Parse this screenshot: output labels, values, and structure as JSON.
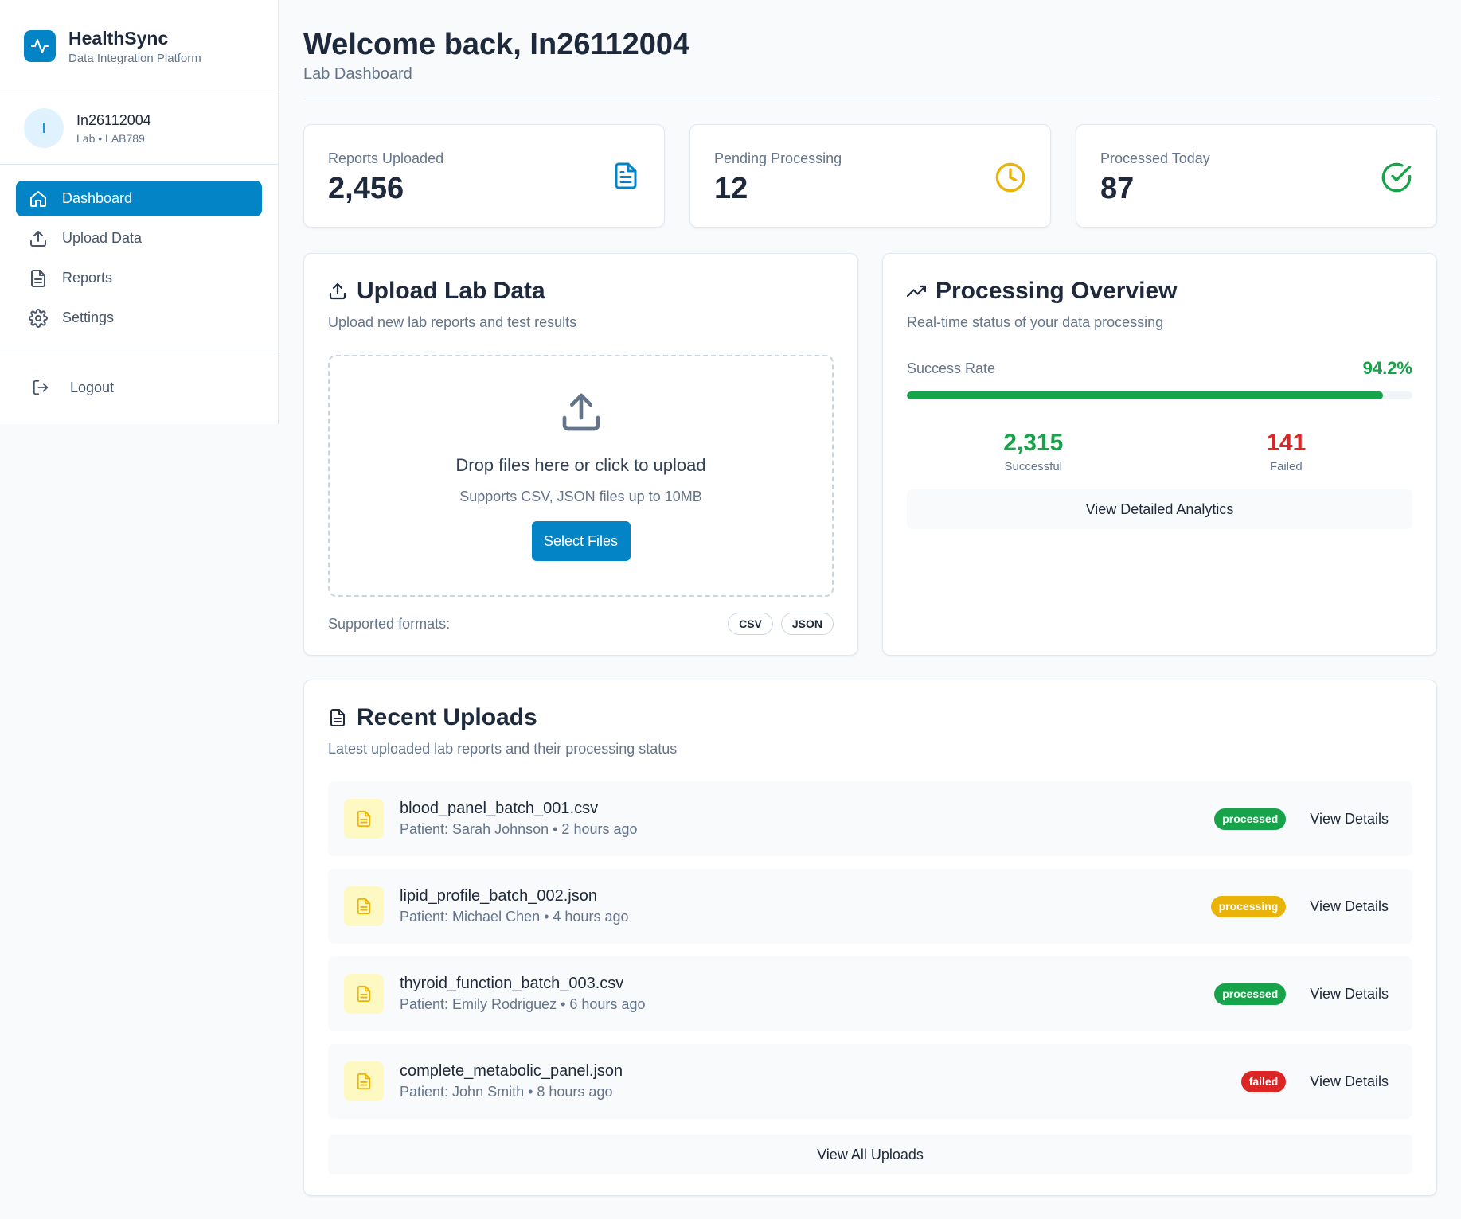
{
  "brand": {
    "name": "HealthSync",
    "subtitle": "Data Integration Platform",
    "accent": "#0284c7"
  },
  "user": {
    "initial": "I",
    "name": "In26112004",
    "meta": "Lab • LAB789"
  },
  "nav": {
    "items": [
      {
        "label": "Dashboard",
        "icon": "home-icon",
        "active": true
      },
      {
        "label": "Upload Data",
        "icon": "upload-icon",
        "active": false
      },
      {
        "label": "Reports",
        "icon": "document-icon",
        "active": false
      },
      {
        "label": "Settings",
        "icon": "gear-icon",
        "active": false
      }
    ],
    "logout": "Logout"
  },
  "header": {
    "title": "Welcome back, In26112004",
    "subtitle": "Lab Dashboard"
  },
  "stats": [
    {
      "label": "Reports Uploaded",
      "value": "2,456",
      "icon": "document-icon",
      "color": "#0284c7"
    },
    {
      "label": "Pending Processing",
      "value": "12",
      "icon": "clock-icon",
      "color": "#eab308"
    },
    {
      "label": "Processed Today",
      "value": "87",
      "icon": "check-circle-icon",
      "color": "#16a34a"
    }
  ],
  "upload": {
    "title": "Upload Lab Data",
    "subtitle": "Upload new lab reports and test results",
    "drop_title": "Drop files here or click to upload",
    "drop_sub": "Supports CSV, JSON files up to 10MB",
    "button": "Select Files",
    "formats_label": "Supported formats:",
    "formats": [
      "CSV",
      "JSON"
    ]
  },
  "processing": {
    "title": "Processing Overview",
    "subtitle": "Real-time status of your data processing",
    "rate_label": "Success Rate",
    "rate_value": "94.2%",
    "rate_fraction": 0.942,
    "successful_count": "2,315",
    "successful_label": "Successful",
    "failed_count": "141",
    "failed_label": "Failed",
    "button": "View Detailed Analytics",
    "success_color": "#16a34a",
    "failed_color": "#dc2626"
  },
  "recent": {
    "title": "Recent Uploads",
    "subtitle": "Latest uploaded lab reports and their processing status",
    "rows": [
      {
        "file": "blood_panel_batch_001.csv",
        "meta": "Patient: Sarah Johnson • 2 hours ago",
        "status": "processed",
        "status_color": "#16a34a",
        "action": "View Details"
      },
      {
        "file": "lipid_profile_batch_002.json",
        "meta": "Patient: Michael Chen • 4 hours ago",
        "status": "processing",
        "status_color": "#eab308",
        "action": "View Details"
      },
      {
        "file": "thyroid_function_batch_003.csv",
        "meta": "Patient: Emily Rodriguez • 6 hours ago",
        "status": "processed",
        "status_color": "#16a34a",
        "action": "View Details"
      },
      {
        "file": "complete_metabolic_panel.json",
        "meta": "Patient: John Smith • 8 hours ago",
        "status": "failed",
        "status_color": "#dc2626",
        "action": "View Details"
      }
    ],
    "button": "View All Uploads"
  }
}
